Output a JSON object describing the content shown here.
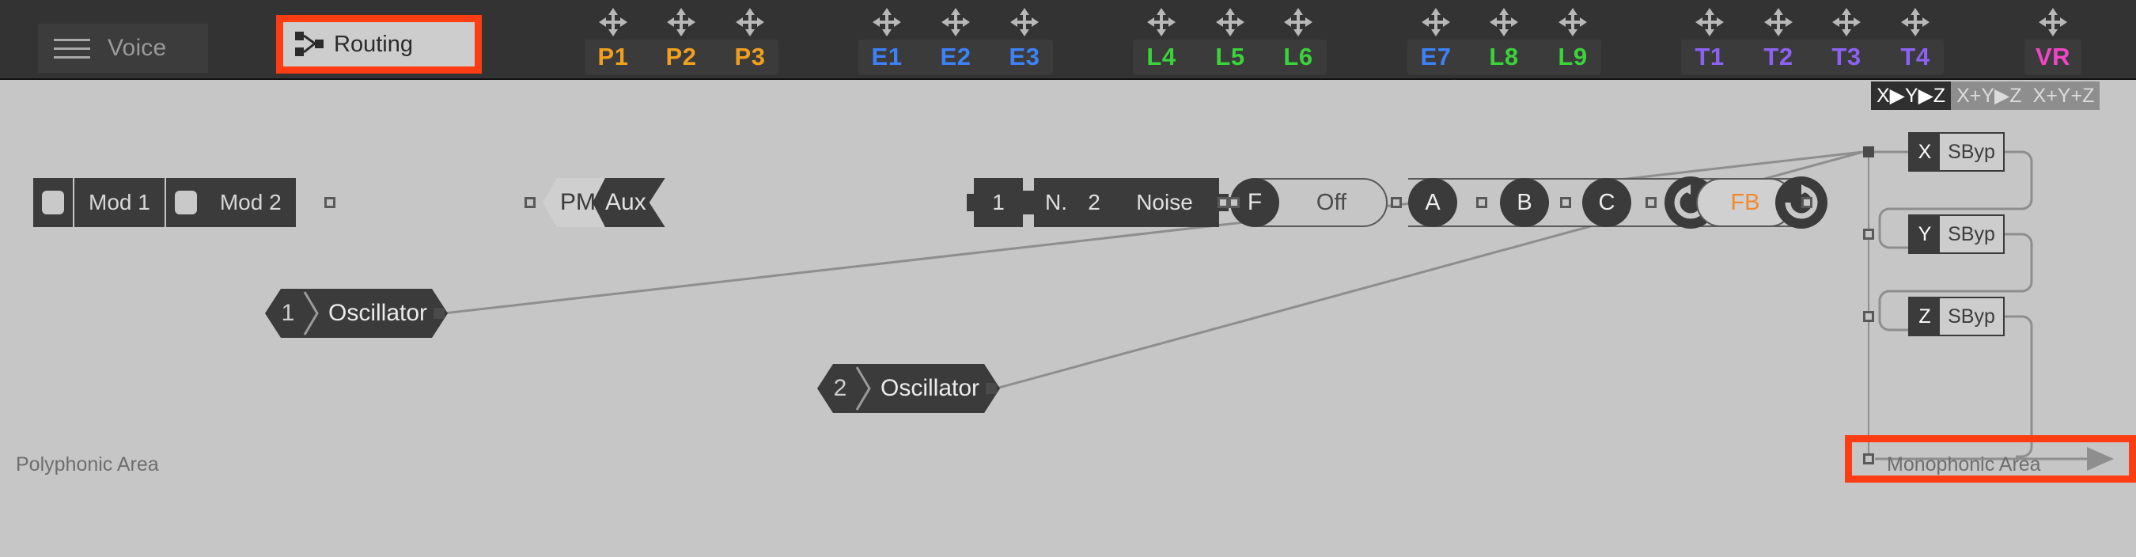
{
  "app": {
    "accent_red": "#fc3d14",
    "canvas_bg": "#c6c6c6",
    "header_bg": "#333333",
    "module_dark": "#3b3b3b"
  },
  "header": {
    "menu_icon": "hamburger-icon",
    "voice_label": "Voice",
    "routing_icon": "routing-graph-icon",
    "routing_label": "Routing",
    "move_icon": "move-arrows-icon",
    "mod_groups": [
      {
        "name": "pitch",
        "color": "#f0a01e",
        "slots": [
          {
            "label": "P1"
          },
          {
            "label": "P2"
          },
          {
            "label": "P3"
          }
        ]
      },
      {
        "name": "envelope",
        "color": "#3d82f7",
        "slots": [
          {
            "label": "E1"
          },
          {
            "label": "E2"
          },
          {
            "label": "E3"
          }
        ]
      },
      {
        "name": "lfo-low",
        "color": "#3ad43a",
        "slots": [
          {
            "label": "L4"
          },
          {
            "label": "L5"
          },
          {
            "label": "L6"
          }
        ]
      },
      {
        "name": "mixed",
        "color": "#3ad43a",
        "slots": [
          {
            "label": "E7",
            "color": "#3d82f7"
          },
          {
            "label": "L8",
            "color": "#3ad43a"
          },
          {
            "label": "L9",
            "color": "#3ad43a"
          }
        ]
      },
      {
        "name": "track",
        "color": "#8c62f5",
        "slots": [
          {
            "label": "T1"
          },
          {
            "label": "T2"
          },
          {
            "label": "T3"
          },
          {
            "label": "T4"
          }
        ]
      },
      {
        "name": "velocity-random",
        "color": "#f344c8",
        "slots": [
          {
            "label": "VR"
          }
        ]
      }
    ]
  },
  "canvas": {
    "polyphonic_area_label": "Polyphonic Area",
    "monophonic_area_label": "Monophonic Area",
    "mod_module": {
      "switch_1": "mod-1-toggle",
      "mod_1_label": "Mod 1",
      "switch_2": "mod-2-toggle",
      "mod_2_label": "Mod 2"
    },
    "pm_aux": {
      "left_label": "PM",
      "right_label": "Aux"
    },
    "noise_module": {
      "index_1": "1",
      "n_label": "N.",
      "index_2": "2",
      "name": "Noise"
    },
    "filter_module": {
      "knob_label": "F",
      "value": "Off"
    },
    "abc_module": {
      "knobs": [
        "A",
        "B",
        "C"
      ]
    },
    "fb_module": {
      "label": "FB",
      "left_icon": "loop-ccw-icon",
      "right_icon": "loop-cw-icon"
    },
    "oscillators": [
      {
        "num": "1",
        "name": "Oscillator"
      },
      {
        "num": "2",
        "name": "Oscillator"
      }
    ]
  },
  "mono_panel": {
    "modes": [
      {
        "label": "X▶Y▶Z",
        "selected": true
      },
      {
        "label": "X+Y▶Z",
        "selected": false
      },
      {
        "label": "X+Y+Z",
        "selected": false
      }
    ],
    "slots": [
      {
        "key": "X",
        "value": "SByp"
      },
      {
        "key": "Y",
        "value": "SByp"
      },
      {
        "key": "Z",
        "value": "SByp"
      }
    ],
    "output_port": "mono-output-port"
  },
  "highlights": [
    {
      "name": "routing-tab-highlight"
    },
    {
      "name": "mono-output-highlight"
    }
  ]
}
